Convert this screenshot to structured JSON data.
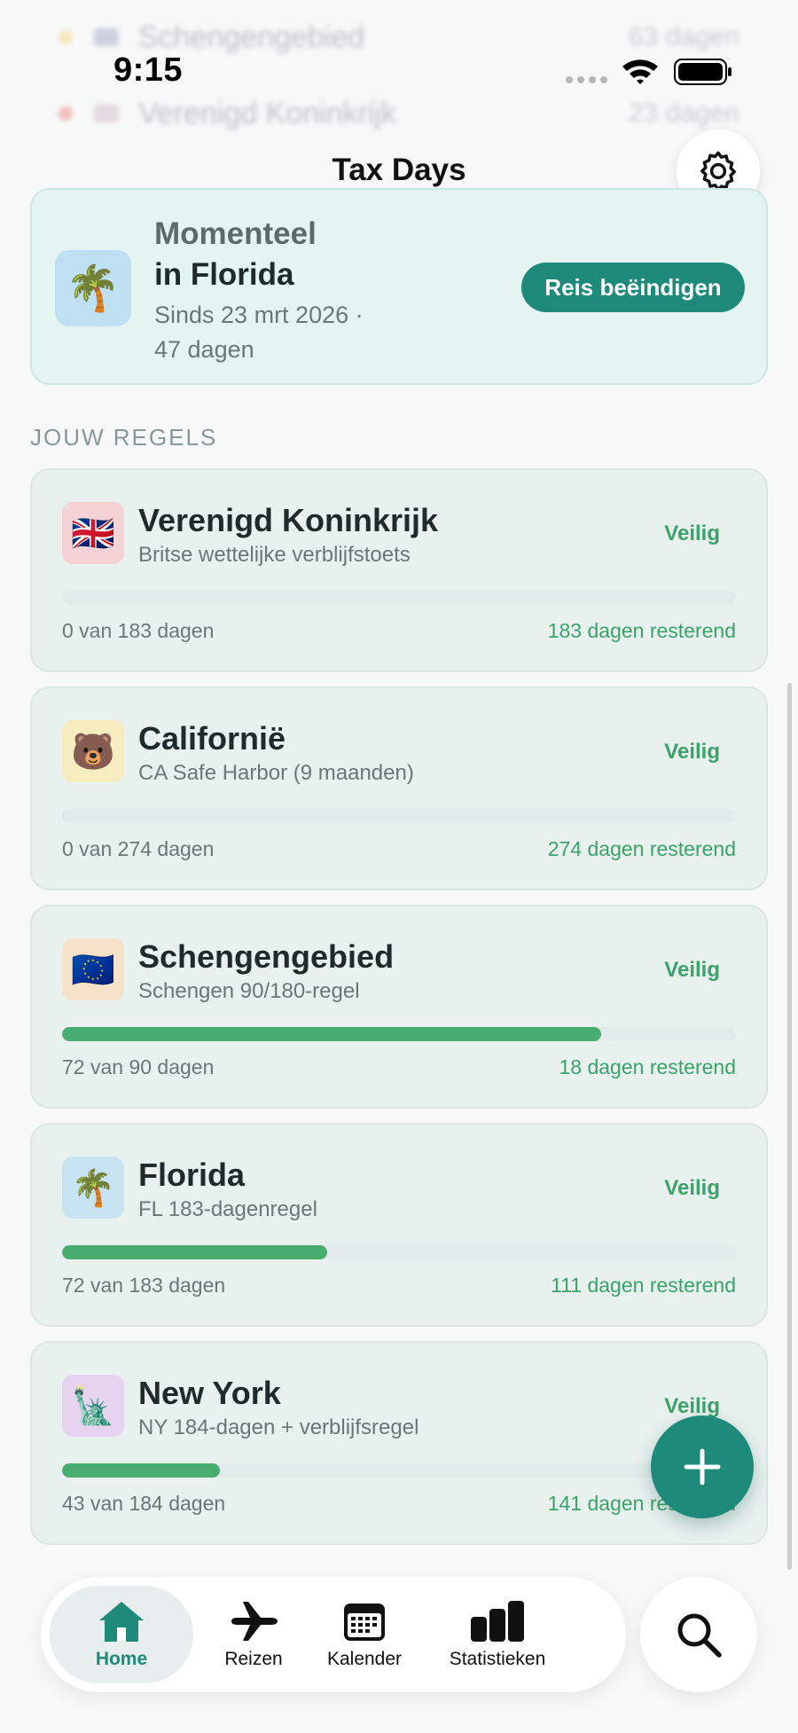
{
  "background_rows": [
    {
      "name": "Schengengebied",
      "value": "63 dagen",
      "dot_color": "#f2c94c"
    },
    {
      "name": "Verenigd Koninkrijk",
      "value": "23 dagen",
      "dot_color": "#eb5757"
    }
  ],
  "status_bar": {
    "time": "9:15"
  },
  "header": {
    "title": "Tax Days",
    "settings_icon": "gear-icon"
  },
  "current": {
    "label": "Momenteel",
    "place": "in Florida",
    "since": "Sinds 23 mrt 2026 ·",
    "days": "47 dagen",
    "icon": "🌴",
    "end_button": "Reis beëindigen"
  },
  "section_title": "JOUW REGELS",
  "rules": [
    {
      "name": "Verenigd Koninkrijk",
      "subtitle": "Britse wettelijke verblijfstoets",
      "status": "Veilig",
      "count": "0 van 183 dagen",
      "remaining": "183 dagen resterend",
      "progress": 0,
      "icon": "🇬🇧",
      "icon_bg": "#f4d3d6"
    },
    {
      "name": "Californië",
      "subtitle": "CA Safe Harbor (9 maanden)",
      "status": "Veilig",
      "count": "0 van 274 dagen",
      "remaining": "274 dagen resterend",
      "progress": 0,
      "icon": "🐻",
      "icon_bg": "#f6ecc0"
    },
    {
      "name": "Schengengebied",
      "subtitle": "Schengen 90/180-regel",
      "status": "Veilig",
      "count": "72 van 90 dagen",
      "remaining": "18 dagen resterend",
      "progress": 0.8,
      "icon": "🇪🇺",
      "icon_bg": "#f5e2c8"
    },
    {
      "name": "Florida",
      "subtitle": "FL 183-dagenregel",
      "status": "Veilig",
      "count": "72 van 183 dagen",
      "remaining": "111 dagen resterend",
      "progress": 0.393,
      "icon": "🌴",
      "icon_bg": "#c8e4f3"
    },
    {
      "name": "New York",
      "subtitle": "NY 184-dagen + verblijfsregel",
      "status": "Veilig",
      "count": "43 van 184 dagen",
      "remaining": "141 dagen resterend",
      "progress": 0.234,
      "icon": "🗽",
      "icon_bg": "#e6d3f0"
    }
  ],
  "tabs": [
    {
      "label": "Home",
      "icon": "house-icon",
      "active": true
    },
    {
      "label": "Reizen",
      "icon": "airplane-icon",
      "active": false
    },
    {
      "label": "Kalender",
      "icon": "calendar-icon",
      "active": false
    },
    {
      "label": "Statistieken",
      "icon": "bar-chart-icon",
      "active": false
    }
  ],
  "colors": {
    "accent": "#1d8a7a",
    "safe": "#3aa36a",
    "progress": "#4aad70"
  }
}
